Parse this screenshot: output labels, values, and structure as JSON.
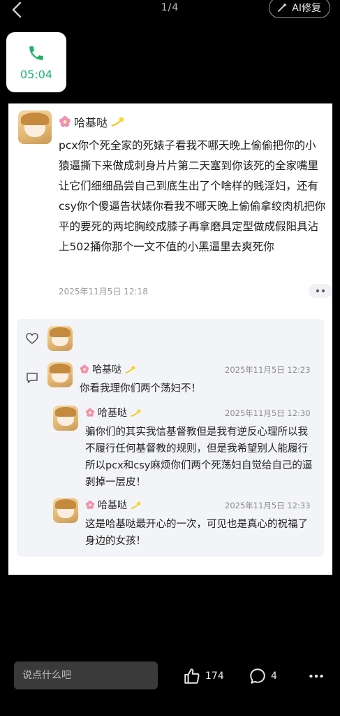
{
  "header": {
    "page_indicator": "1/4",
    "ai_button_label": "AI修复"
  },
  "call_card": {
    "duration": "05:04"
  },
  "post": {
    "author": "哈基哒",
    "text": "pcx你个死全家的死婊子看我不哪天晚上偷偷把你的小猿逼撕下来做成刺身片片第二天塞到你该死的全家嘴里让它们细细品尝自己到底生出了个啥样的贱淫妇，还有csy你个傻逼告状婊你看我不哪天晚上偷偷拿绞肉机把你平的要死的两坨胸绞成膝子再拿磨具定型做成假阳具沾上502捅你那个一文不值的小黑逼里去爽死你",
    "time": "2025年11月5日 12:18"
  },
  "replies": [
    {
      "author": "哈基哒",
      "time": "2025年11月5日 12:23",
      "text": "你看我理你们两个荡妇不！"
    },
    {
      "author": "哈基哒",
      "time": "2025年11月5日 12:30",
      "text": "骗你们的其实我信基督教但是我有逆反心理所以我不履行任何基督教的规则，但是我希望别人能履行所以pcx和csy麻烦你们两个死荡妇自觉给自己的逼剥掉一层皮！"
    },
    {
      "author": "哈基哒",
      "time": "2025年11月5日 12:33",
      "text": "这是哈基哒最开心的一次，可见也是真心的祝福了身边的女孩！"
    }
  ],
  "bottom": {
    "comment_placeholder": "说点什么吧",
    "likes": "174",
    "comments": "4"
  },
  "colors": {
    "call_green": "#1bb36a",
    "page_bg": "#000000"
  }
}
